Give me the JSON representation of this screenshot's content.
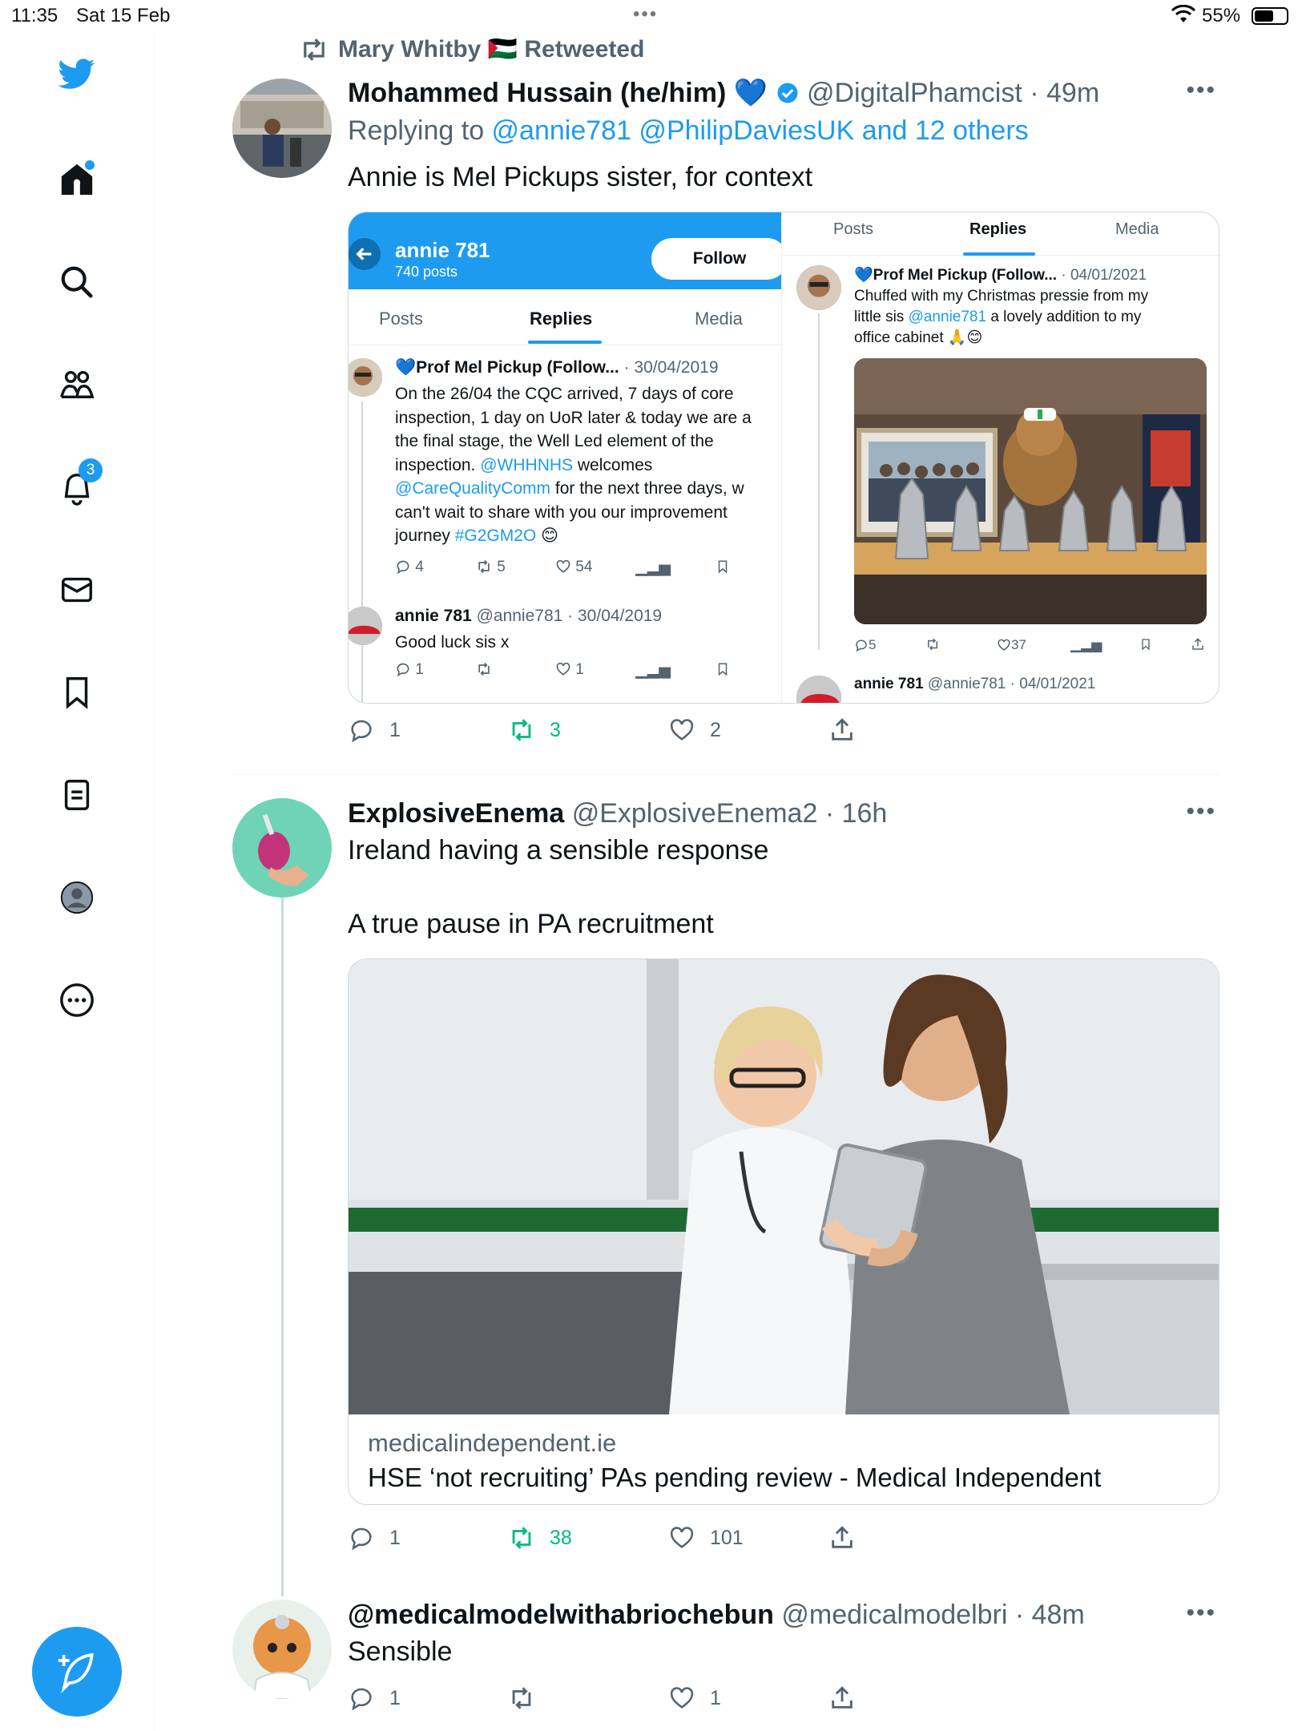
{
  "status_bar": {
    "time": "11:35",
    "date": "Sat 15 Feb",
    "battery": "55%"
  },
  "sidebar": {
    "notifications_count": "3",
    "items": [
      "home",
      "search",
      "communities",
      "notifications",
      "messages",
      "bookmarks",
      "lists",
      "profile",
      "more"
    ]
  },
  "tweet1": {
    "retweeted_by": "Mary Whitby 🇵🇸 Retweeted",
    "name": "Mohammed Hussain (he/him) 💙",
    "handle": "@DigitalPhamcist",
    "time": "· 49m",
    "replying_prefix": "Replying to ",
    "replying_to": "@annie781 @PhilipDaviesUK and 12 others",
    "text": "Annie is Mel Pickups sister, for context",
    "replies": "1",
    "retweets": "3",
    "likes": "2",
    "embed": {
      "profile_name": "annie 781",
      "profile_posts": "740 posts",
      "follow_label": "Follow",
      "tabs": [
        "Posts",
        "Replies",
        "Media"
      ],
      "left_post1": {
        "name": "💙Prof Mel Pickup (Follow...",
        "meta": "· 30/04/2019",
        "text_a": "On the 26/04 the CQC arrived, 7 days of core\ninspection, 1 day on UoR later & today we are a\nthe  final stage, the  Well Led element of the\ninspection. ",
        "mention1": "@WHHNHS",
        "text_b": " welcomes",
        "mention2": "@CareQualityComm",
        "text_c": " for the next three days, w\ncan't wait to share with you our improvement\njourney ",
        "hashtag": "#G2GM2O",
        "emoji": " 😊",
        "replies": "4",
        "retweets": "5",
        "likes": "54"
      },
      "left_post2": {
        "name": "annie 781",
        "handle": "@annie781",
        "meta": "· 30/04/2019",
        "text": "Good luck sis x",
        "replies": "1",
        "likes": "1"
      },
      "right_post1": {
        "name": "💙Prof Mel Pickup (Follow...",
        "meta": "· 04/01/2021",
        "text_a": "Chuffed with my Christmas pressie from my\nlittle sis ",
        "mention": "@annie781",
        "text_b": " a lovely addition to my\noffice cabinet 🙏😊",
        "replies": "5",
        "likes": "37"
      },
      "right_post2": {
        "name": "annie 781",
        "handle": "@annie781",
        "meta": "· 04/01/2021"
      }
    }
  },
  "tweet2": {
    "name": "ExplosiveEnema",
    "handle": "@ExplosiveEnema2",
    "time": "· 16h",
    "text": "Ireland having a sensible response\n\nA true pause in PA recruitment",
    "card_domain": "medicalindependent.ie",
    "card_title": "HSE ‘not recruiting’ PAs pending review - Medical Independent",
    "replies": "1",
    "retweets": "38",
    "likes": "101"
  },
  "tweet3": {
    "name": "@medicalmodelwithabriochebun",
    "handle": "@medicalmodelbri",
    "time": "· 48m",
    "text": "Sensible",
    "replies": "1",
    "likes": "1"
  },
  "colors": {
    "accent": "#1d9bf0",
    "retweet_green": "#00ba7c",
    "muted": "#536471"
  }
}
